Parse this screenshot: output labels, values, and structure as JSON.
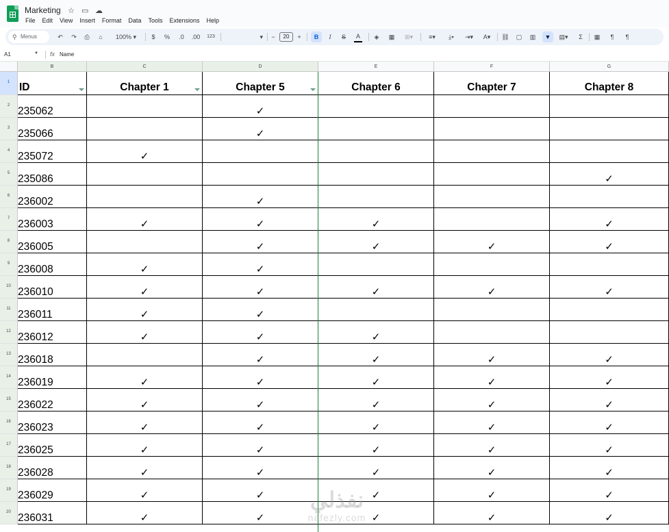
{
  "app": {
    "doc_title": "Marketing",
    "menu": [
      "File",
      "Edit",
      "View",
      "Insert",
      "Format",
      "Data",
      "Tools",
      "Extensions",
      "Help"
    ]
  },
  "toolbar": {
    "search_placeholder": "Menus",
    "zoom": "100%",
    "currency": "$",
    "percent": "%",
    "dec_decrease": ".0",
    "dec_increase": ".00",
    "number_format": "123",
    "font_size": "20",
    "minus": "−",
    "plus": "+"
  },
  "formula_bar": {
    "cell_ref": "A1",
    "fx": "fx",
    "value": "Name"
  },
  "sheet": {
    "columns": [
      "B",
      "C",
      "D",
      "E",
      "F",
      "G"
    ],
    "header_row": [
      "ID",
      "Chapter 1",
      "Chapter 5",
      "Chapter 6",
      "Chapter 7",
      "Chapter 8"
    ],
    "check_symbol": "✓",
    "rows": [
      {
        "n": "2",
        "id": "235062",
        "c": [
          0,
          1,
          0,
          0,
          0
        ]
      },
      {
        "n": "3",
        "id": "235066",
        "c": [
          0,
          1,
          0,
          0,
          0
        ]
      },
      {
        "n": "4",
        "id": "235072",
        "c": [
          1,
          0,
          0,
          0,
          0
        ]
      },
      {
        "n": "5",
        "id": "235086",
        "c": [
          0,
          0,
          0,
          0,
          1
        ]
      },
      {
        "n": "6",
        "id": "236002",
        "c": [
          0,
          1,
          0,
          0,
          0
        ]
      },
      {
        "n": "7",
        "id": "236003",
        "c": [
          1,
          1,
          1,
          0,
          1
        ]
      },
      {
        "n": "8",
        "id": "236005",
        "c": [
          0,
          1,
          1,
          1,
          1
        ]
      },
      {
        "n": "9",
        "id": "236008",
        "c": [
          1,
          1,
          0,
          0,
          0
        ]
      },
      {
        "n": "10",
        "id": "236010",
        "c": [
          1,
          1,
          1,
          1,
          1
        ]
      },
      {
        "n": "11",
        "id": "236011",
        "c": [
          1,
          1,
          0,
          0,
          0
        ]
      },
      {
        "n": "12",
        "id": "236012",
        "c": [
          1,
          1,
          1,
          0,
          0
        ]
      },
      {
        "n": "13",
        "id": "236018",
        "c": [
          0,
          1,
          1,
          1,
          1
        ]
      },
      {
        "n": "14",
        "id": "236019",
        "c": [
          1,
          1,
          1,
          1,
          1
        ]
      },
      {
        "n": "15",
        "id": "236022",
        "c": [
          1,
          1,
          1,
          1,
          1
        ]
      },
      {
        "n": "16",
        "id": "236023",
        "c": [
          1,
          1,
          1,
          1,
          1
        ]
      },
      {
        "n": "17",
        "id": "236025",
        "c": [
          1,
          1,
          1,
          1,
          1
        ]
      },
      {
        "n": "18",
        "id": "236028",
        "c": [
          1,
          1,
          1,
          1,
          1
        ]
      },
      {
        "n": "19",
        "id": "236029",
        "c": [
          1,
          1,
          1,
          1,
          1
        ]
      },
      {
        "n": "20",
        "id": "236031",
        "c": [
          1,
          1,
          1,
          1,
          1
        ]
      }
    ]
  },
  "watermark": {
    "logo": "نفذلي",
    "site": "nafezly.com"
  }
}
